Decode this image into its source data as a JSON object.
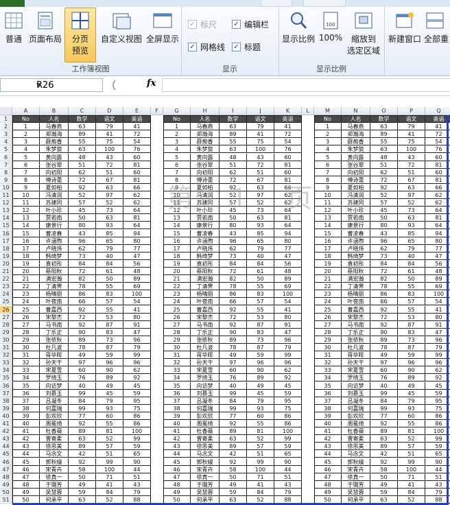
{
  "ribbon": {
    "workbook_views": {
      "label": "工作簿视图",
      "normal": "普通",
      "page_layout": "页面布局",
      "page_break_preview": [
        "分页",
        "预览"
      ],
      "custom_views": "自定义视图",
      "full_screen": "全屏显示"
    },
    "show": {
      "label": "显示",
      "ruler": "标尺",
      "formula_bar": "编辑栏",
      "gridlines": "网格线",
      "headings": "标题"
    },
    "zoom": {
      "label": "显示比例",
      "zoom": "显示比例",
      "hundred": "100%",
      "zoom_to_selection": [
        "缩放到",
        "选定区域"
      ]
    },
    "window": {
      "new_window": "新建窗口",
      "arrange_all": "全部重"
    }
  },
  "formula_bar": {
    "name_box": "R26",
    "fx": "fx",
    "value": ""
  },
  "watermark": "第 1 页",
  "sheet": {
    "column_letters": [
      "A",
      "B",
      "C",
      "D",
      "E",
      "F",
      "G",
      "H",
      "I",
      "J",
      "K",
      "L",
      "M",
      "N",
      "O",
      "P",
      "Q"
    ],
    "headers": [
      "No",
      "人名",
      "数学",
      "语文",
      "英语"
    ],
    "selected_row": 26,
    "rows": [
      [
        "1",
        "马春燕",
        "63",
        "79",
        "41"
      ],
      [
        "2",
        "郑瀚海",
        "89",
        "41",
        "72"
      ],
      [
        "3",
        "薛痴香",
        "55",
        "75",
        "54"
      ],
      [
        "4",
        "朱梦旋",
        "63",
        "100",
        "76"
      ],
      [
        "5",
        "黄向露",
        "48",
        "43",
        "60"
      ],
      [
        "6",
        "张谷翠",
        "51",
        "72",
        "81"
      ],
      [
        "7",
        "向初阳",
        "62",
        "51",
        "60"
      ],
      [
        "8",
        "傅诗蕾",
        "72",
        "67",
        "81"
      ],
      [
        "9",
        "夏如柏",
        "92",
        "63",
        "66"
      ],
      [
        "10",
        "冯清润",
        "52",
        "97",
        "62"
      ],
      [
        "11",
        "苏建同",
        "57",
        "52",
        "62"
      ],
      [
        "12",
        "叶小珍",
        "45",
        "73",
        "64"
      ],
      [
        "13",
        "贾若南",
        "50",
        "63",
        "81"
      ],
      [
        "14",
        "康景行",
        "80",
        "93",
        "64"
      ],
      [
        "15",
        "曹凌春",
        "43",
        "85",
        "94"
      ],
      [
        "16",
        "许涵煦",
        "96",
        "65",
        "80"
      ],
      [
        "17",
        "卢晓炜",
        "62",
        "79",
        "77"
      ],
      [
        "18",
        "韩绮梦",
        "73",
        "40",
        "47"
      ],
      [
        "19",
        "袁初彤",
        "84",
        "84",
        "56"
      ],
      [
        "20",
        "蔡阳秋",
        "72",
        "61",
        "48"
      ],
      [
        "21",
        "满宏瀚",
        "82",
        "50",
        "89"
      ],
      [
        "22",
        "丁清霁",
        "78",
        "55",
        "69"
      ],
      [
        "23",
        "杨晴丽",
        "86",
        "83",
        "100"
      ],
      [
        "24",
        "叶夜南",
        "66",
        "57",
        "54"
      ],
      [
        "25",
        "曹嘉西",
        "92",
        "55",
        "41"
      ],
      [
        "26",
        "宋黎杰",
        "72",
        "53",
        "80"
      ],
      [
        "27",
        "马书南",
        "92",
        "87",
        "91"
      ],
      [
        "28",
        "丁乐正",
        "90",
        "83",
        "47"
      ],
      [
        "29",
        "张依秋",
        "89",
        "73",
        "96"
      ],
      [
        "30",
        "杜凡波",
        "78",
        "87",
        "79"
      ],
      [
        "31",
        "蒋华晖",
        "49",
        "59",
        "99"
      ],
      [
        "32",
        "孙天干",
        "97",
        "96",
        "96"
      ],
      [
        "33",
        "宋夏雪",
        "60",
        "90",
        "62"
      ],
      [
        "34",
        "罗绮玉",
        "76",
        "89",
        "92"
      ],
      [
        "35",
        "向访梦",
        "40",
        "49",
        "45"
      ],
      [
        "36",
        "刘慕玉",
        "99",
        "45",
        "59"
      ],
      [
        "37",
        "吕凝冬",
        "84",
        "79",
        "95"
      ],
      [
        "38",
        "何嘉瑞",
        "99",
        "93",
        "75"
      ],
      [
        "39",
        "彭欢欣",
        "77",
        "60",
        "86"
      ],
      [
        "40",
        "周冕绮",
        "92",
        "55",
        "86"
      ],
      [
        "41",
        "杜香薇",
        "89",
        "81",
        "100"
      ],
      [
        "42",
        "曾寄柔",
        "63",
        "52",
        "99"
      ],
      [
        "43",
        "徐思美",
        "89",
        "57",
        "59"
      ],
      [
        "44",
        "马念文",
        "42",
        "51",
        "65"
      ],
      [
        "45",
        "郭秋嫚",
        "92",
        "99",
        "90"
      ],
      [
        "46",
        "宋青卉",
        "58",
        "100",
        "44"
      ],
      [
        "47",
        "徐真一",
        "50",
        "71",
        "51"
      ],
      [
        "48",
        "于璐芳",
        "49",
        "41",
        "43"
      ],
      [
        "49",
        "吴慧蓉",
        "59",
        "84",
        "79"
      ],
      [
        "50",
        "何承平",
        "63",
        "52",
        "88"
      ]
    ]
  }
}
